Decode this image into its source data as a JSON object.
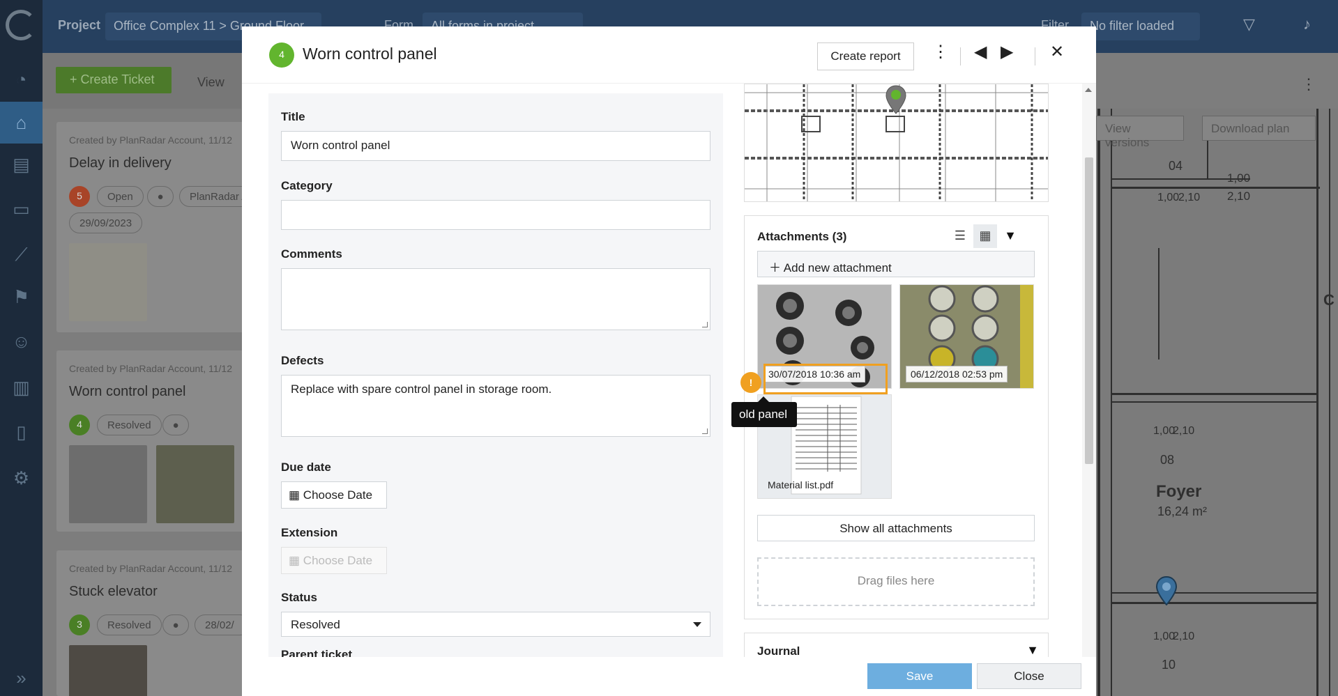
{
  "topbar": {
    "project_label": "Project",
    "project_value": "Office Complex 11 > Ground Floor",
    "form_label": "Form",
    "form_value": "All forms in project",
    "filter_label": "Filter",
    "filter_value": "No filter loaded"
  },
  "toolbar": {
    "create_ticket": "+ Create Ticket",
    "view_label": "View"
  },
  "tickets": [
    {
      "meta": "Created by PlanRadar Account, 11/12",
      "title": "Delay in delivery",
      "number": "5",
      "status": "Open",
      "assignee": "PlanRadar A",
      "date": "29/09/2023",
      "num_color": "#a84428"
    },
    {
      "meta": "Created by PlanRadar Account, 11/12",
      "title": "Worn control panel",
      "number": "4",
      "status": "Resolved",
      "num_color": "#4a7f25"
    },
    {
      "meta": "Created by PlanRadar Account, 11/12",
      "title": "Stuck elevator",
      "number": "3",
      "status": "Resolved",
      "date": "28/02/",
      "num_color": "#4a7f25"
    }
  ],
  "plan": {
    "view_versions": "View versions",
    "download_plan": "Download plan",
    "room_name": "Foyer",
    "room_area": "16,24 m²",
    "dims": [
      "1,00",
      "2,10",
      "1,00",
      "2,10",
      "1,00",
      "2,10",
      "1,00",
      "2,10"
    ],
    "room_numbers": [
      "04",
      "08",
      "10"
    ],
    "edge_letter": "C"
  },
  "modal": {
    "number": "4",
    "title": "Worn control panel",
    "create_report": "Create report",
    "fields": {
      "title_label": "Title",
      "title_value": "Worn control panel",
      "category_label": "Category",
      "category_value": "",
      "comments_label": "Comments",
      "comments_value": "",
      "defects_label": "Defects",
      "defects_value": "Replace with spare control panel in storage room.",
      "due_date_label": "Due date",
      "due_date_btn": "Choose Date",
      "extension_label": "Extension",
      "extension_btn": "Choose Date",
      "status_label": "Status",
      "status_value": "Resolved",
      "parent_label": "Parent ticket"
    },
    "attachments": {
      "title": "Attachments (3)",
      "add": "Add new attachment",
      "items": [
        {
          "label": "30/07/2018 10:36 am",
          "kind": "photo"
        },
        {
          "label": "06/12/2018 02:53 pm",
          "kind": "photo"
        },
        {
          "label": "Material list.pdf",
          "kind": "pdf"
        }
      ],
      "show_all": "Show all attachments",
      "drag": "Drag files here"
    },
    "journal_title": "Journal",
    "save": "Save",
    "close": "Close"
  },
  "tooltip": {
    "badge": "!",
    "text": "old panel"
  },
  "colors": {
    "accent_green": "#62b52e",
    "save_blue": "#6daedf",
    "highlight_orange": "#f0a020",
    "topbar": "#26405f",
    "sidebar": "#1c2a3b"
  }
}
